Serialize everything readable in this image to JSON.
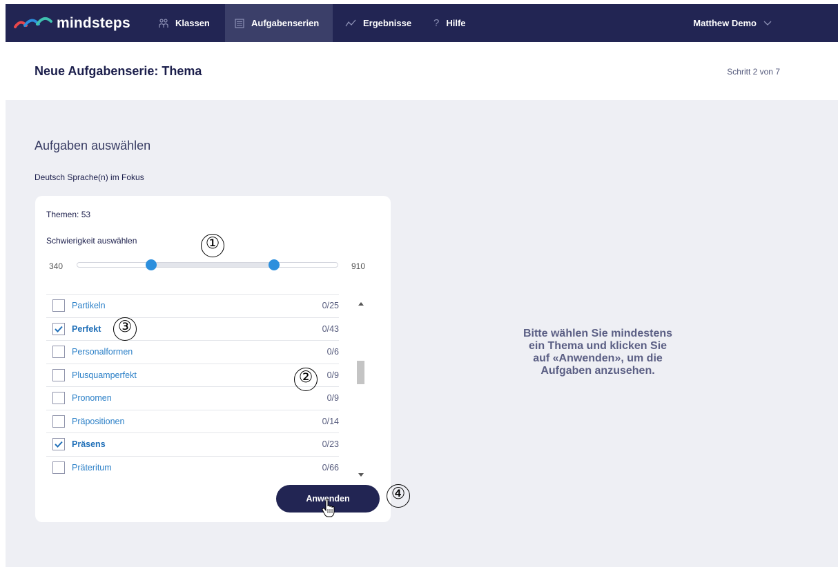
{
  "brand": {
    "logo_text": "mindsteps"
  },
  "nav": {
    "items": [
      {
        "label": "Klassen",
        "icon": "people-icon"
      },
      {
        "label": "Aufgabenserien",
        "icon": "list-icon",
        "active": true
      },
      {
        "label": "Ergebnisse",
        "icon": "chart-icon"
      },
      {
        "label": "Hilfe",
        "icon": "question-icon"
      }
    ],
    "user": "Matthew Demo"
  },
  "header": {
    "title": "Neue Aufgabenserie: Thema",
    "step": "Schritt 2 von 7"
  },
  "main": {
    "section_title": "Aufgaben auswählen",
    "subtitle": "Deutsch Sprache(n) im Fokus",
    "card": {
      "themen": "Themen: 53",
      "difficulty_label": "Schwierigkeit auswählen",
      "slider": {
        "min": "340",
        "max": "910",
        "lower_fraction": 0.285,
        "upper_fraction": 0.755
      },
      "topics": [
        {
          "label": "Partikeln",
          "count": "0/25",
          "checked": false
        },
        {
          "label": "Perfekt",
          "count": "0/43",
          "checked": true
        },
        {
          "label": "Personalformen",
          "count": "0/6",
          "checked": false
        },
        {
          "label": "Plusquamperfekt",
          "count": "0/9",
          "checked": false
        },
        {
          "label": "Pronomen",
          "count": "0/9",
          "checked": false
        },
        {
          "label": "Präpositionen",
          "count": "0/14",
          "checked": false
        },
        {
          "label": "Präsens",
          "count": "0/23",
          "checked": true
        },
        {
          "label": "Präteritum",
          "count": "0/66",
          "checked": false
        }
      ],
      "apply_label": "Anwenden"
    },
    "hint": "Bitte wählen Sie mindestens ein Thema und klicken Sie auf «Anwenden», um die Aufgaben anzusehen."
  },
  "annotations": {
    "m1": "①",
    "m2": "②",
    "m3": "③",
    "m4": "④"
  },
  "colors": {
    "navbar": "#222553",
    "accent": "#2c8fdd",
    "background": "#eeeff4",
    "link": "#2a7fc7"
  }
}
